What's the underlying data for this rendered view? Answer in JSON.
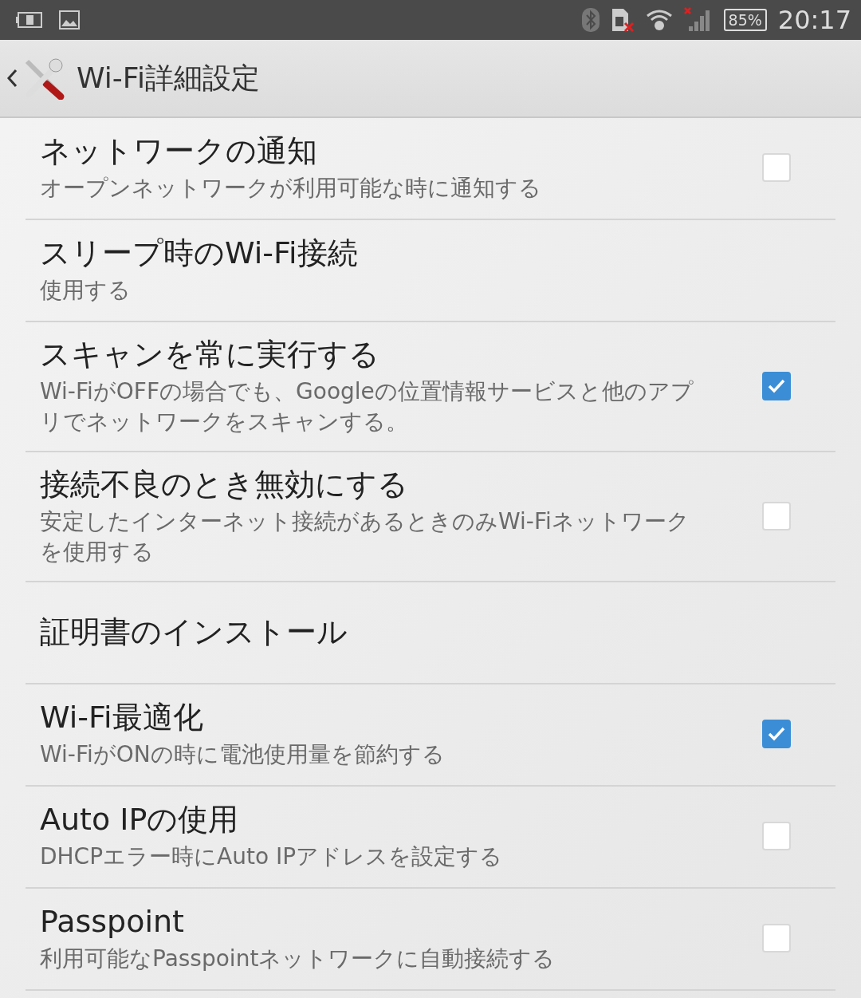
{
  "status_bar": {
    "battery": "85%",
    "time": "20:17"
  },
  "header": {
    "title": "Wi-Fi詳細設定"
  },
  "settings": [
    {
      "kind": "checkbox",
      "title": "ネットワークの通知",
      "summary": "オープンネットワークが利用可能な時に通知する",
      "checked": false
    },
    {
      "kind": "plain",
      "title": "スリープ時のWi-Fi接続",
      "summary": "使用する"
    },
    {
      "kind": "checkbox",
      "title": "スキャンを常に実行する",
      "summary": "Wi-FiがOFFの場合でも、Googleの位置情報サービスと他のアプリでネットワークをスキャンする。",
      "checked": true
    },
    {
      "kind": "checkbox",
      "title": "接続不良のとき無効にする",
      "summary": "安定したインターネット接続があるときのみWi-Fiネットワークを使用する",
      "checked": false
    },
    {
      "kind": "plain",
      "title": "証明書のインストール"
    },
    {
      "kind": "checkbox",
      "title": "Wi-Fi最適化",
      "summary": "Wi-FiがONの時に電池使用量を節約する",
      "checked": true
    },
    {
      "kind": "checkbox",
      "title": "Auto IPの使用",
      "summary": "DHCPエラー時にAuto IPアドレスを設定する",
      "checked": false
    },
    {
      "kind": "checkbox",
      "title": "Passpoint",
      "summary": "利用可能なPasspointネットワークに自動接続する",
      "checked": false
    }
  ]
}
